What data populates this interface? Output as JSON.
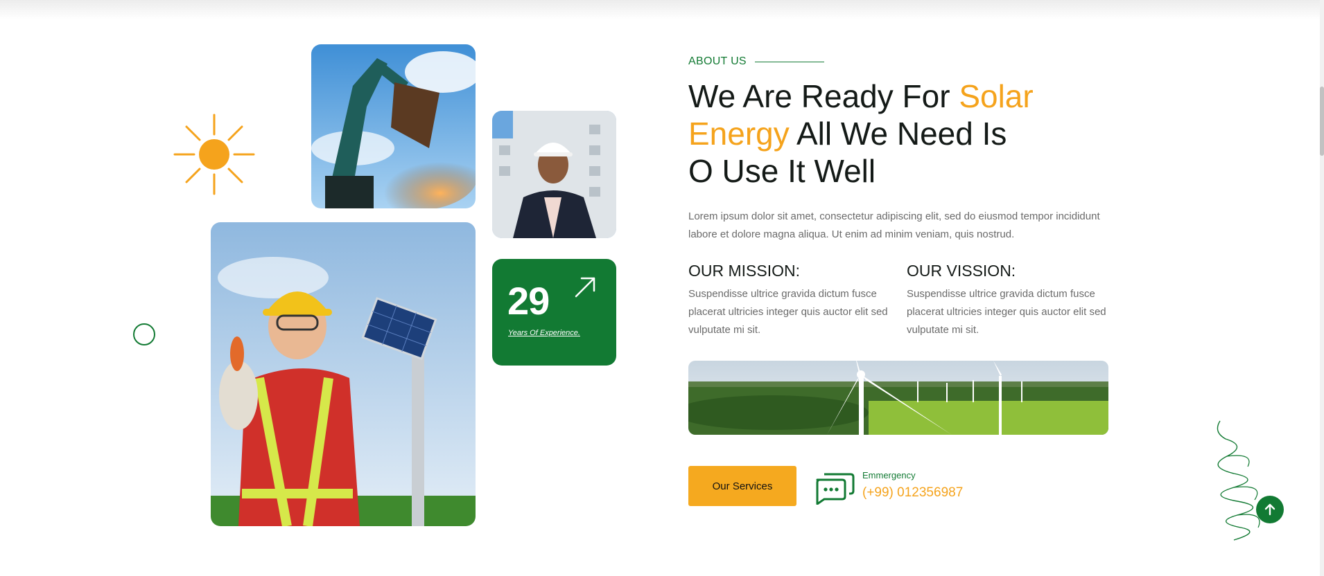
{
  "about": {
    "eyebrow": "ABOUT US",
    "headline": {
      "part1": "We Are Ready For ",
      "accent1": "Solar",
      "accent2": "Energy",
      "part2": " All We Need Is",
      "line3": "O Use It Well"
    },
    "intro": "Lorem ipsum dolor sit amet, consectetur adipiscing elit, sed do eiusmod tempor incididunt labore et dolore magna aliqua. Ut enim ad minim veniam, quis nostrud.",
    "mission": {
      "title": "OUR MISSION:",
      "text": "Suspendisse ultrice gravida dictum fusce placerat ultricies integer quis auctor elit sed vulputate mi sit."
    },
    "vision": {
      "title": "OUR VISSION:",
      "text": "Suspendisse ultrice gravida dictum fusce placerat ultricies integer quis auctor elit sed vulputate mi sit."
    },
    "services_button": "Our Services",
    "emergency": {
      "label": "Emmergency",
      "phone": "(+99) 012356987"
    }
  },
  "experience": {
    "number": "29",
    "label": "Years Of Experience."
  },
  "icons": {
    "experience_arrow": "arrow-up-right-icon",
    "chat": "chat-bubbles-icon",
    "back_to_top": "arrow-up-icon",
    "sun": "sun-icon"
  },
  "colors": {
    "brand_green": "#127a33",
    "accent_orange": "#f5a31c"
  }
}
